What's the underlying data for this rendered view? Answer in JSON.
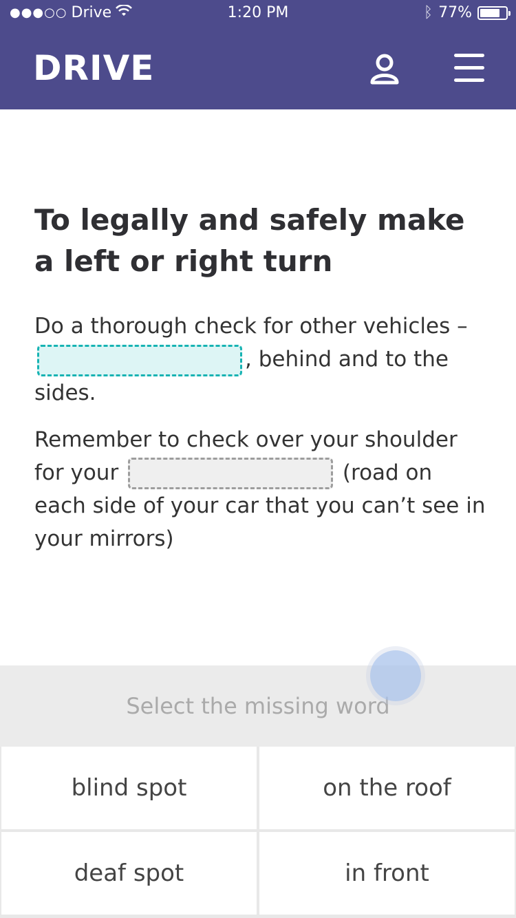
{
  "status_bar": {
    "carrier": "Drive",
    "time": "1:20 PM",
    "battery_percent": "77%",
    "battery_level": 0.77
  },
  "header": {
    "logo": "DRIVE",
    "profile_icon": "user-icon",
    "menu_icon": "hamburger-menu-icon",
    "background_color": "#4d4b8c"
  },
  "question": {
    "title": "To legally and safely make a left or right turn",
    "paragraph1_before": "Do a thorough check for other vehicles –",
    "paragraph1_after": ", behind and to the sides.",
    "paragraph2_before": "Remember to check over your shoulder for your",
    "paragraph2_after": "(road on each side of your car that you can’t see in your mirrors)"
  },
  "selector": {
    "label": "Select the missing word"
  },
  "options": [
    {
      "label": "blind spot"
    },
    {
      "label": "on the roof"
    },
    {
      "label": "deaf spot"
    },
    {
      "label": "in front"
    }
  ],
  "colors": {
    "active_blank_border": "#17b3b3",
    "active_blank_fill": "#ddf5f5",
    "idle_blank_border": "#9d9d9d"
  }
}
